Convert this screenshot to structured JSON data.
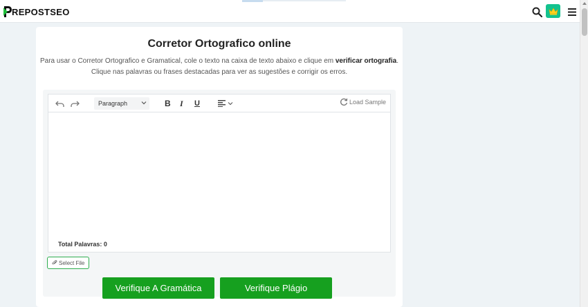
{
  "header": {
    "logo_text": "REPOSTSEO",
    "icons": {
      "search": "search-icon",
      "premium": "crown-icon",
      "menu": "hamburger-menu-icon"
    }
  },
  "main": {
    "title": "Corretor Ortografico online",
    "description_line1_pre": "Para usar o Corretor Ortografico e Gramatical, cole o texto na caixa de texto abaixo e clique em ",
    "description_line1_bold": "verificar ortografia",
    "description_line1_post": ".",
    "description_line2": "Clique nas palavras ou frases destacadas para ver as sugestões e corrigir os erros."
  },
  "editor": {
    "block_format": "Paragraph",
    "bold_label": "B",
    "italic_label": "I",
    "underline_label": "U",
    "load_sample_label": "Load Sample",
    "word_count_label": "Total Palavras:",
    "word_count_value": "0",
    "select_file_label": "Select File"
  },
  "actions": {
    "check_grammar_label": "Verifique A Gramática",
    "check_plagiarism_label": "Verifique Plágio"
  },
  "colors": {
    "accent_green": "#16a01f",
    "crown_bg": "#13c28e",
    "page_bg": "#eef3f6"
  }
}
